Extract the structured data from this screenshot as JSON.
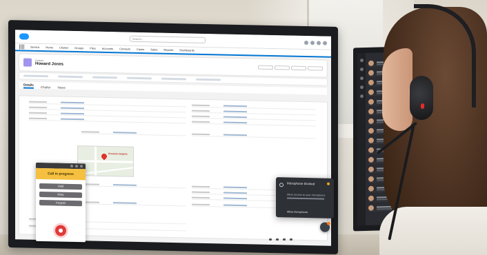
{
  "main_screen": {
    "app_name": "Service",
    "nav_items": [
      "Home",
      "Chatter",
      "Groups",
      "Files",
      "Accounts",
      "Contacts",
      "Cases",
      "Sales",
      "Reports",
      "Dashboards"
    ],
    "search_placeholder": "Search...",
    "record_type": "Contact",
    "record_name": "Howard Jones",
    "tabs": [
      "Details",
      "Chatter",
      "News"
    ],
    "map_label": "Dreamin Heights"
  },
  "call_panel": {
    "status": "Call in progress",
    "buttons": [
      "Hold",
      "Mute",
      "Keypad"
    ]
  },
  "notification": {
    "title": "Microphone blocked",
    "subtitle": "Allow access to your microphone",
    "action": "Allow microphone"
  },
  "colors": {
    "brand_blue": "#0176d3",
    "call_status": "#f5c040",
    "end_call": "#e03a3a",
    "notice_bg": "#2d3035",
    "headset_light": "#e52b2b"
  }
}
